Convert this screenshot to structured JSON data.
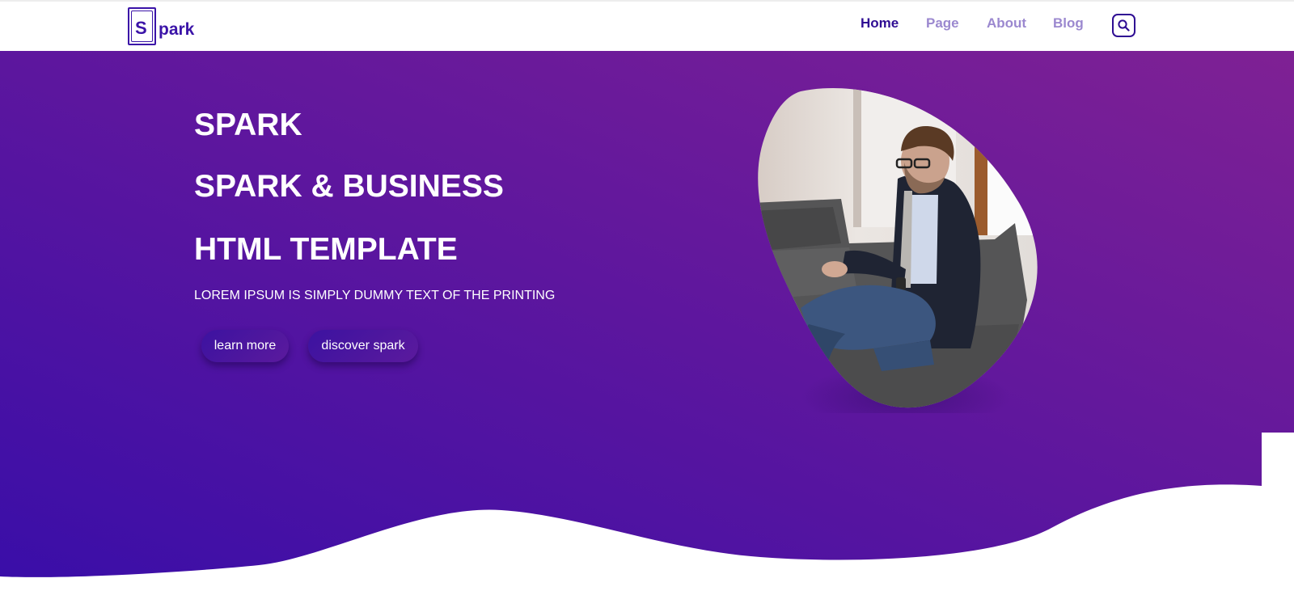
{
  "brand": {
    "logo_letter": "S",
    "logo_rest": "park"
  },
  "nav": {
    "items": [
      {
        "label": "Home",
        "active": true
      },
      {
        "label": "Page",
        "active": false
      },
      {
        "label": "About",
        "active": false
      },
      {
        "label": "Blog",
        "active": false
      }
    ],
    "search_icon": "search-icon"
  },
  "hero": {
    "title": "SPARK",
    "subtitle": "SPARK & BUSINESS",
    "subtitle2_regular": "HTML ",
    "subtitle2_bold": "TEMPLATE",
    "description": "LOREM IPSUM IS SIMPLY DUMMY TEXT OF THE PRINTING",
    "buttons": {
      "learn_more": "learn more",
      "discover": "discover spark"
    },
    "image_subject": "man-on-sofa-photo"
  },
  "colors": {
    "brand": "#3b14a8",
    "nav_active": "#2f0d93",
    "nav_inactive": "#9b88cf",
    "gradient_start": "#3a0ea8",
    "gradient_end": "#7f2194"
  }
}
